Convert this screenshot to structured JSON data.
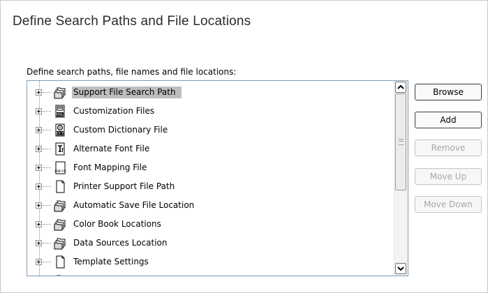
{
  "dialog": {
    "title": "Define Search Paths and File Locations",
    "caption": "Define search paths, file names and file locations:"
  },
  "tree": {
    "items": [
      {
        "label": "Support File Search Path",
        "icon": "folder-stack-icon",
        "selected": true
      },
      {
        "label": "Customization Files",
        "icon": "menu-file-icon"
      },
      {
        "label": "Custom Dictionary File",
        "icon": "dictionary-file-icon"
      },
      {
        "label": "Alternate Font File",
        "icon": "font-file-icon"
      },
      {
        "label": "Font Mapping File",
        "icon": "font-mapping-file-icon"
      },
      {
        "label": "Printer Support File Path",
        "icon": "document-icon"
      },
      {
        "label": "Automatic Save File Location",
        "icon": "folder-stack-icon"
      },
      {
        "label": "Color Book Locations",
        "icon": "folder-stack-icon"
      },
      {
        "label": "Data Sources Location",
        "icon": "folder-stack-icon"
      },
      {
        "label": "Template Settings",
        "icon": "document-icon"
      }
    ],
    "icon_text": {
      "menu": "MNU",
      "dictionary": "DCT",
      "font_mapping": "FMP PS"
    }
  },
  "buttons": {
    "browse": "Browse",
    "add": "Add",
    "remove": "Remove",
    "move_up": "Move Up",
    "move_down": "Move Down"
  },
  "colors": {
    "selection": "#bdbdbd",
    "tree_border": "#7f9db9",
    "disabled_text": "#a8a8a8"
  }
}
